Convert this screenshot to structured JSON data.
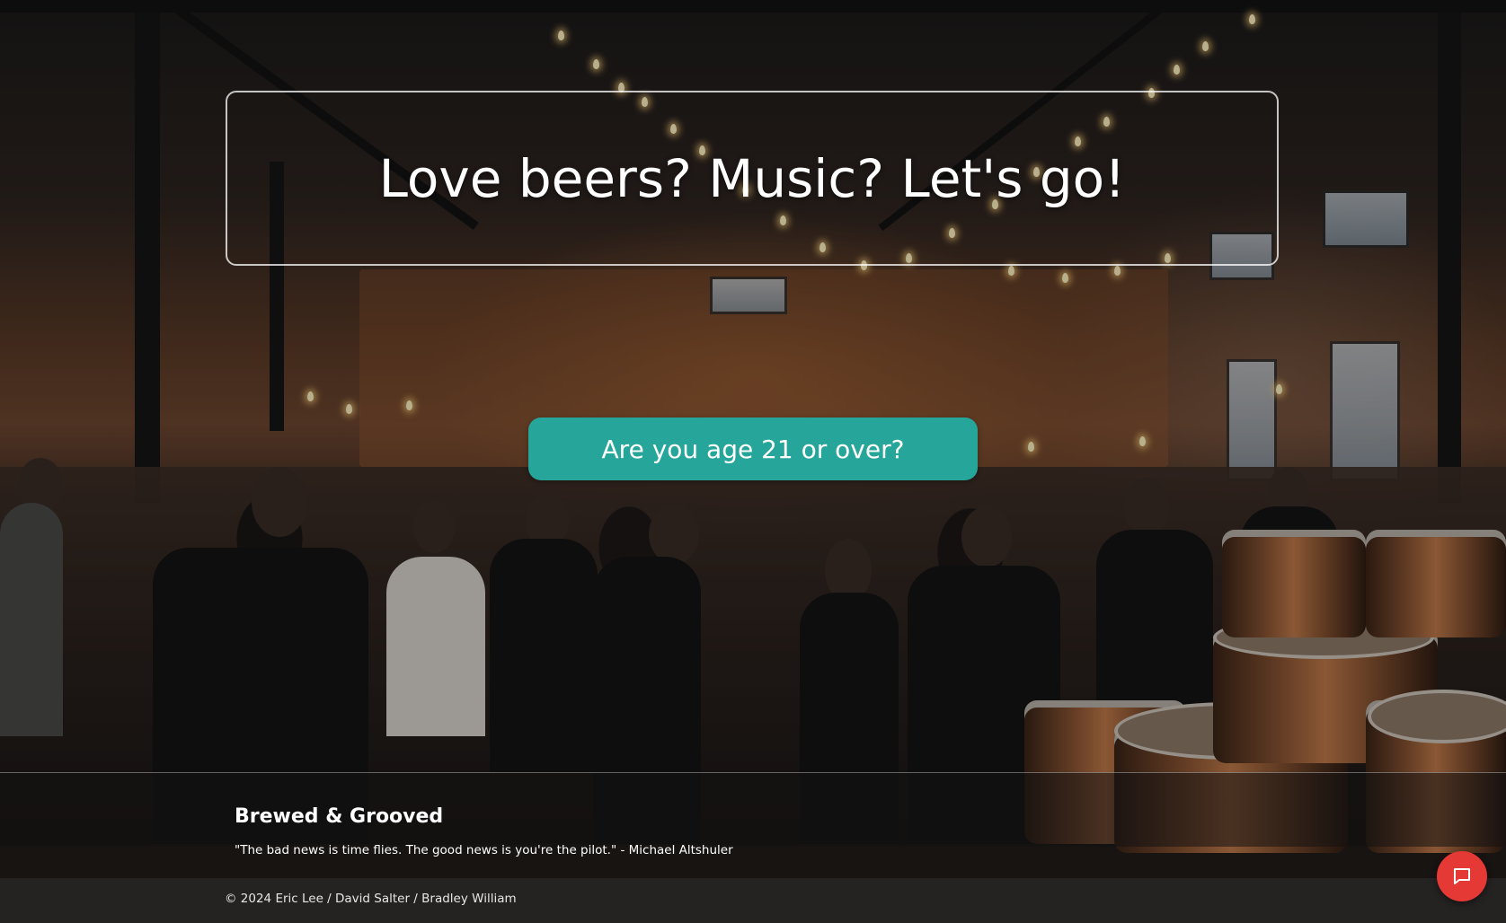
{
  "hero": {
    "headline": "Love beers? Music? Let's go!"
  },
  "age_gate": {
    "button_label": "Are you age 21 or over?",
    "accent_color": "#26a69a"
  },
  "footer": {
    "brand": "Brewed & Grooved",
    "quote": "\"The bad news is time flies. The good news is you're the pilot.\" - Michael Altshuler",
    "copyright": "© 2024 Eric Lee / David Salter / Bradley William"
  },
  "chat": {
    "icon": "chat-bubble-icon",
    "color": "#e53935"
  }
}
